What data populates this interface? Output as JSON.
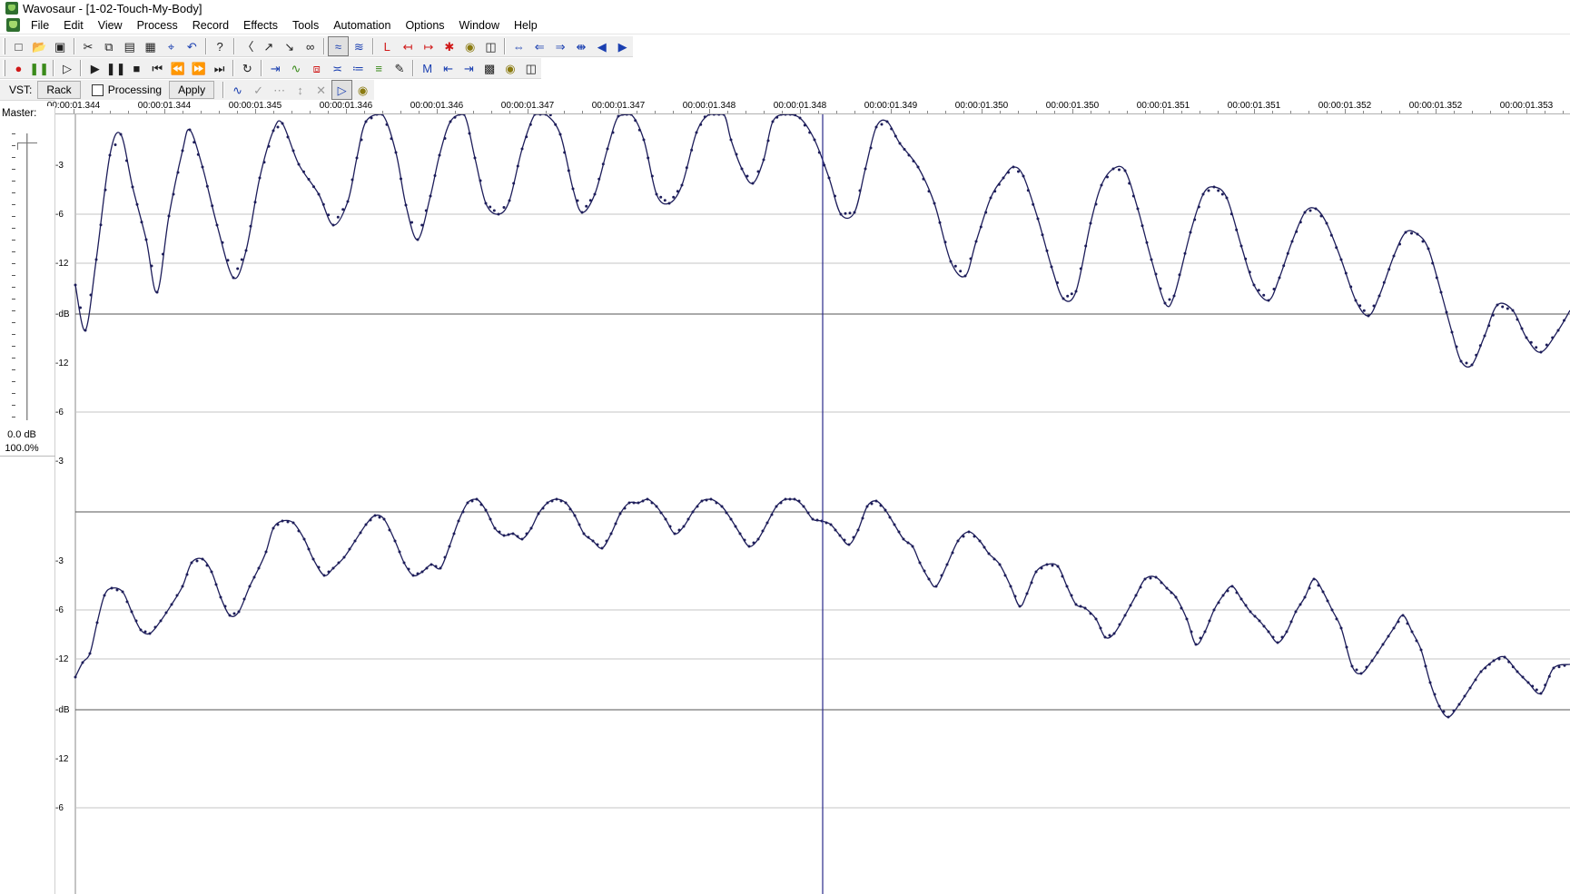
{
  "window": {
    "title": "Wavosaur - [1-02-Touch-My-Body]"
  },
  "menu": [
    "File",
    "Edit",
    "View",
    "Process",
    "Record",
    "Effects",
    "Tools",
    "Automation",
    "Options",
    "Window",
    "Help"
  ],
  "toolbar3": {
    "vst_label": "VST:",
    "rack_label": "Rack",
    "processing_label": "Processing",
    "apply_label": "Apply"
  },
  "ruler": {
    "ticks": [
      "00:00:01.344",
      "00:00:01.344",
      "00:00:01.345",
      "00:00:01.346",
      "00:00:01.346",
      "00:00:01.347",
      "00:00:01.347",
      "00:00:01.348",
      "00:00:01.348",
      "00:00:01.349",
      "00:00:01.350",
      "00:00:01.350",
      "00:00:01.351",
      "00:00:01.351",
      "00:00:01.352",
      "00:00:01.352",
      "00:00:01.353"
    ]
  },
  "master": {
    "label": "Master:",
    "db_value": "0.0 dB",
    "percent": "100.0%",
    "level": 1.0
  },
  "channels": [
    {
      "db_labels": [
        "-3",
        "-6",
        "-12",
        "-dB",
        "-12",
        "-6",
        "-3"
      ]
    },
    {
      "db_labels": [
        "-3",
        "-6",
        "-12",
        "-dB",
        "-12",
        "-6"
      ]
    }
  ],
  "icons": {
    "toolbar1": [
      "new-file-icon",
      "open-file-icon",
      "save-icon",
      "cut-icon",
      "copy-icon",
      "paste-icon",
      "paste-special-icon",
      "crop-icon",
      "undo-icon",
      "help-icon",
      "mute-icon",
      "fade-in-icon",
      "fade-out-icon",
      "link-icon",
      "waveform-select-icon",
      "waveform-all-icon",
      "marker-icon",
      "marker-left-icon",
      "marker-right-icon",
      "marker-delete-all-icon",
      "lock-icon",
      "trash-icon",
      "zoom-in-icon",
      "zoom-out-icon",
      "zoom-fit-icon",
      "zoom-selection-icon",
      "scroll-left-icon",
      "scroll-right-icon"
    ],
    "toolbar2": [
      "record-icon",
      "pause-record-icon",
      "play-from-cursor-icon",
      "play-icon",
      "pause-icon",
      "stop-icon",
      "skip-start-icon",
      "rewind-icon",
      "fast-forward-icon",
      "skip-end-icon",
      "loop-icon",
      "loop-insert-icon",
      "spectrum-icon",
      "copy-region-icon",
      "normalize-icon",
      "eq-icon",
      "stereo-icon",
      "pencil-icon",
      "marker-m-icon",
      "marker-prev-icon",
      "marker-next-icon",
      "film-icon",
      "lock-icon",
      "trash-icon"
    ],
    "toolbar3": [
      "automation-curve-icon",
      "check-icon",
      "dots-icon",
      "arrow-icon",
      "close-icon",
      "play-selection-icon",
      "lock-icon"
    ]
  },
  "colors": {
    "waveform": "#1d1d5a",
    "cursor": "#2a2a8a",
    "grid": "#c4c4c4",
    "center_line": "#555555",
    "toolbar": "#f0f0f0"
  }
}
